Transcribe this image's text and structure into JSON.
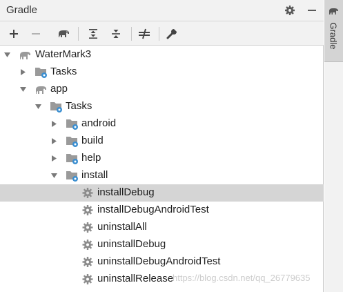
{
  "panel": {
    "title": "Gradle",
    "header_icons": [
      "gear-icon",
      "minimize-icon"
    ]
  },
  "toolbar": {
    "buttons": [
      "add-icon",
      "remove-icon",
      "gradle-elephant-icon",
      "expand-all-icon",
      "collapse-all-icon",
      "toggle-offline-icon",
      "wrench-icon"
    ]
  },
  "tree": {
    "root": "WaterMark3",
    "root_tasks": "Tasks",
    "app": "app",
    "app_tasks": "Tasks",
    "groups": {
      "android": "android",
      "build": "build",
      "help": "help",
      "install": "install"
    },
    "install_tasks": [
      "installDebug",
      "installDebugAndroidTest",
      "uninstallAll",
      "uninstallDebug",
      "uninstallDebugAndroidTest",
      "uninstallRelease"
    ],
    "selected": "installDebug"
  },
  "side_tab": {
    "label": "Gradle"
  },
  "watermark": "https://blog.csdn.net/qq_26779635",
  "colors": {
    "selection": "#d5d5d5",
    "gear_blue": "#3b8fd1",
    "icon_gray": "#8c8c8c"
  }
}
